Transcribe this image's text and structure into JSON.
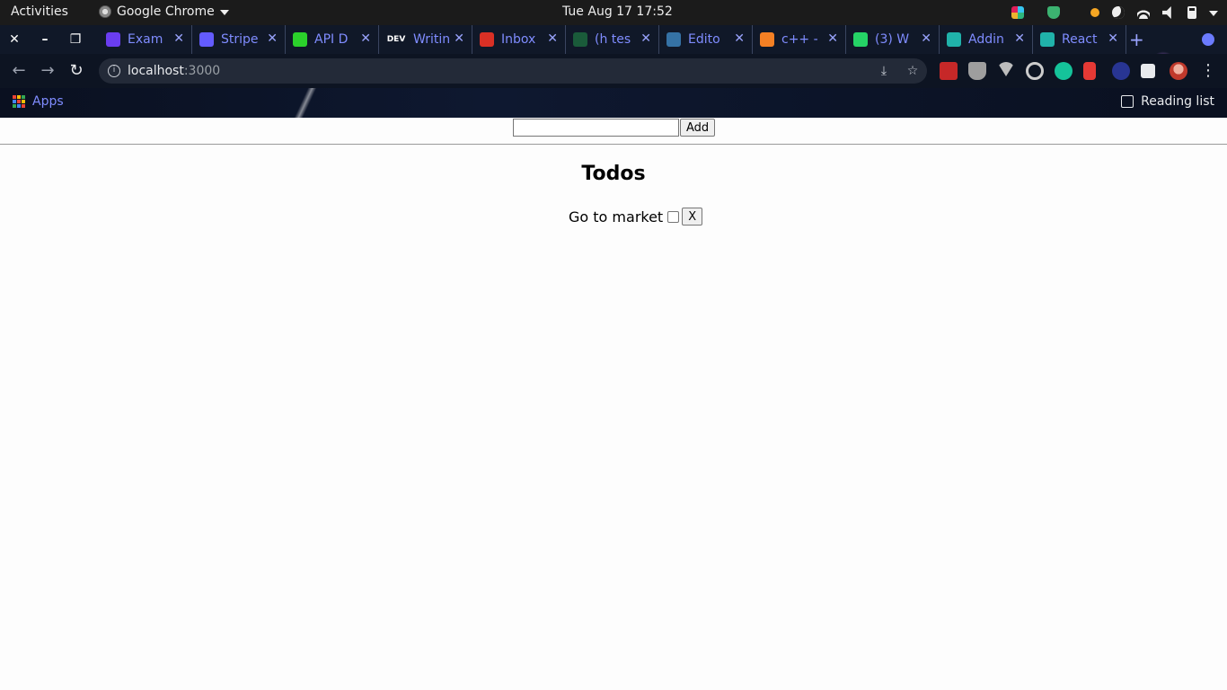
{
  "system_bar": {
    "activities": "Activities",
    "app_name": "Google Chrome",
    "datetime": "Tue Aug 17  17:52"
  },
  "browser": {
    "tabs": [
      {
        "label": "Exam",
        "color": "#6a3df0"
      },
      {
        "label": "Stripe",
        "color": "#635bff"
      },
      {
        "label": "API D",
        "color": "#2bd12b"
      },
      {
        "label": "Writin",
        "color": "#111111"
      },
      {
        "label": "Inbox",
        "color": "#d93025"
      },
      {
        "label": "(h tes",
        "color": "#1a5b3a"
      },
      {
        "label": "Edito",
        "color": "#3572a5"
      },
      {
        "label": "c++ -",
        "color": "#f48024"
      },
      {
        "label": "(3) W",
        "color": "#25d366"
      },
      {
        "label": "Addin",
        "color": "#20b2aa"
      },
      {
        "label": "React",
        "color": "#20b2aa"
      }
    ],
    "dev_badge": "DEV",
    "url_host": "localhost",
    "url_port": ":3000",
    "bookmarks_apps": "Apps",
    "reading_list": "Reading list",
    "icons": [
      "back-icon",
      "forward-icon",
      "reload-icon",
      "info-icon",
      "install-icon",
      "star-icon",
      "extensions-icon",
      "menu-icon"
    ]
  },
  "app": {
    "input_value": "",
    "add_label": "Add",
    "heading": "Todos",
    "todos": [
      {
        "text": "Go to market",
        "done": false,
        "remove_label": "X"
      }
    ]
  }
}
